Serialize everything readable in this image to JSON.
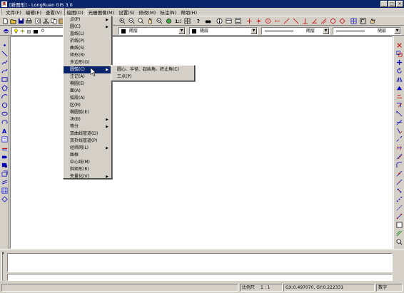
{
  "window": {
    "title": "[新图形] - LongRuan GIS 3.0",
    "icon_label": "R",
    "minimize": "_",
    "maximize": "□",
    "close": "×"
  },
  "menubar": [
    "文件(F)",
    "编辑(E)",
    "查看(V)",
    "绘图(D)",
    "光栅图像(M)",
    "设置(S)",
    "修改(M)",
    "标注(N)",
    "帮助(H)"
  ],
  "active_menu": "绘图(D)",
  "draw_menu": {
    "items": [
      {
        "label": "点(P)",
        "submenu": true
      },
      {
        "label": "圆(C)",
        "submenu": true
      },
      {
        "label": "直线(L)",
        "submenu": false
      },
      {
        "label": "折线(P)",
        "submenu": false
      },
      {
        "label": "曲线(S)",
        "submenu": false
      },
      {
        "label": "矩形(R)",
        "submenu": false
      },
      {
        "label": "多边形(G)",
        "submenu": false
      },
      {
        "label": "圆弧(C)",
        "submenu": true
      },
      {
        "label": "注记(A)",
        "submenu": false
      },
      {
        "label": "椭圆(E)",
        "submenu": false
      },
      {
        "label": "面(A)",
        "submenu": false
      },
      {
        "label": "弧段(A)",
        "submenu": false
      },
      {
        "label": "区(R)",
        "submenu": false
      },
      {
        "label": "椭圆弧(E)",
        "submenu": false
      },
      {
        "label": "块(B)",
        "submenu": true
      },
      {
        "label": "等分",
        "submenu": true
      },
      {
        "label": "双曲线管道(D)",
        "submenu": false
      },
      {
        "label": "双折线管道(P)",
        "submenu": false
      },
      {
        "label": "经纬网(L)",
        "submenu": true
      },
      {
        "label": "图框",
        "submenu": false
      },
      {
        "label": "中心线(M)",
        "submenu": false
      },
      {
        "label": "斜矩形(R)",
        "submenu": false
      },
      {
        "label": "矢量化(V)",
        "submenu": true
      }
    ],
    "highlighted_index": 7
  },
  "arc_submenu": {
    "items": [
      "圆心、半径、起始角、终止角(C)",
      "三点(P)"
    ]
  },
  "layer_bar": {
    "layer_value": "0",
    "color_combo": "随层",
    "linetype_combo": "随层",
    "lineweight_combo": "随层",
    "extra_combo": "随层"
  },
  "status": {
    "scale_label": "比例尺",
    "scale_value": "1 : 1",
    "coords": "GX:0.497070, GY:0.222331",
    "mode": "数字"
  },
  "colors": {
    "titlebar": "#0a246a",
    "face": "#d4d0c8",
    "highlight": "#0a246a",
    "icon_blue": "#0000c0",
    "icon_red": "#c00000"
  },
  "icons": {
    "toolbar_top": [
      "new-icon",
      "open-icon",
      "save-icon",
      "print-icon",
      "cut-icon",
      "copy-icon",
      "zoom-in-icon",
      "zoom-out-icon",
      "zoom-window-icon",
      "pan-icon",
      "zoom-all-icon",
      "zoom-1to1-icon",
      "query-icon",
      "find-icon",
      "info-icon",
      "layers-icon",
      "cross-icon",
      "point-icon",
      "circle-dot-icon",
      "line-icon",
      "perpendicular-icon",
      "angle-icon",
      "circle-icon",
      "diamond-icon",
      "grid-icon",
      "hand-icon"
    ],
    "left": [
      "point-icon",
      "line-icon",
      "polyline-icon",
      "curve-icon",
      "rectangle-icon",
      "polygon-icon",
      "arc-icon",
      "circle-icon",
      "ellipse-icon",
      "undo-arc-icon",
      "text-icon",
      "annotation-icon",
      "block-icon",
      "area-icon",
      "insert-icon",
      "layer-icon",
      "parallel-icon",
      "table-icon",
      "erase-icon"
    ],
    "right": [
      "delete-icon",
      "copy-icon",
      "move-icon",
      "rotate-icon",
      "mirror-icon",
      "offset-icon",
      "array-icon",
      "scale-icon",
      "stretch-icon",
      "trim-icon",
      "extend-icon",
      "break-icon",
      "chamfer-icon",
      "fillet-icon",
      "explode-icon",
      "edit-vertex-icon",
      "join-icon",
      "measure-icon",
      "divide-icon",
      "lengthen-icon",
      "align-icon",
      "properties-icon",
      "match-icon",
      "zoom-icon"
    ]
  }
}
